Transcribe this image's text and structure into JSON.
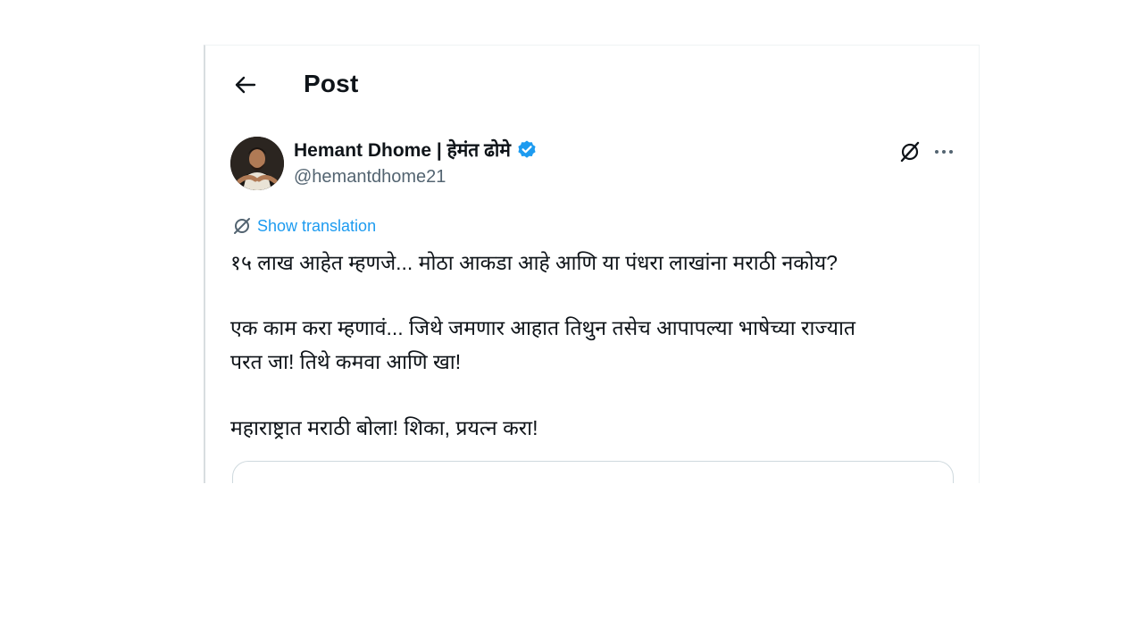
{
  "header": {
    "title": "Post"
  },
  "author": {
    "display_name": "Hemant Dhome | हेमंत ढोमे",
    "handle": "@hemantdhome21"
  },
  "post": {
    "show_translation_label": "Show translation",
    "lines": [
      "१५ लाख आहेत म्हणजे...  मोठा आकडा आहे आणि या पंधरा लाखांना मराठी नकोय?",
      "एक काम करा म्हणावं... जिथे जमणार आहात तिथुन तसेच आपापल्या भाषेच्या राज्यात",
      "परत जा! तिथे कमवा आणि खा!",
      "महाराष्ट्रात मराठी बोला! शिका, प्रयत्न करा!"
    ]
  },
  "icons": {
    "back": "arrow-left-icon",
    "verified": "verified-badge-icon",
    "grok": "grok-icon",
    "more": "more-horizontal-icon",
    "translate": "translate-icon"
  },
  "colors": {
    "accent": "#1d9bf0",
    "text": "#0f1419",
    "secondary": "#536471",
    "border": "#cfd9de"
  }
}
